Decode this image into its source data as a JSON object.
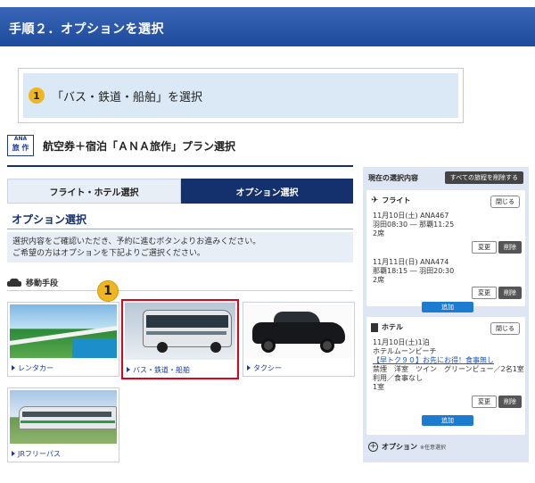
{
  "step_header": {
    "title": "手順２．オプションを選択"
  },
  "instruction": {
    "badge": "1",
    "text": "「バス・鉄道・船舶」を選択"
  },
  "plan": {
    "logo_top": "ANA",
    "logo_bottom": "旅 作",
    "title": "航空券＋宿泊「ＡＮＡ旅作」プラン選択"
  },
  "tabs": [
    {
      "label": "フライト・ホテル選択",
      "active": false
    },
    {
      "label": "オプション選択",
      "active": true
    }
  ],
  "options": {
    "title": "オプション選択",
    "notice_line1": "選択内容をご確認いただき、予約に進むボタンよりお進みください。",
    "notice_line2": "ご希望の方はオプションを下記よりご選択ください。",
    "transport_label": "移動手段",
    "badge": "1",
    "cards": [
      {
        "label": "レンタカー"
      },
      {
        "label": "バス・鉄道・船舶"
      },
      {
        "label": "タクシー"
      },
      {
        "label": "JRフリーパス"
      }
    ]
  },
  "summary": {
    "title": "現在の選択内容",
    "clear_button": "すべての旅程を削除する",
    "flight": {
      "title": "フライト",
      "close": "閉じる",
      "segments": [
        {
          "line1": "11月10日(土) ANA467",
          "line2": "羽田08:30 ― 那覇11:25",
          "line3": "2席"
        },
        {
          "line1": "11月11日(日) ANA474",
          "line2": "那覇18:15 ― 羽田20:30",
          "line3": "2席"
        }
      ],
      "change": "変更",
      "delete": "削除",
      "add": "追加"
    },
    "hotel": {
      "title": "ホテル",
      "close": "閉じる",
      "line1": "11月10日(土)1泊",
      "line2": "ホテルムーンビーチ",
      "link": "【早トク９０】お先にお得！食事無し",
      "line3": "禁煙　洋室　ツイン　グリーンビュー／2名1室",
      "line4": "利用／食事なし",
      "line5": "1室",
      "change": "変更",
      "delete": "削除",
      "add": "追加"
    },
    "option_add": {
      "label": "オプション",
      "sub": "※任意選択"
    }
  }
}
